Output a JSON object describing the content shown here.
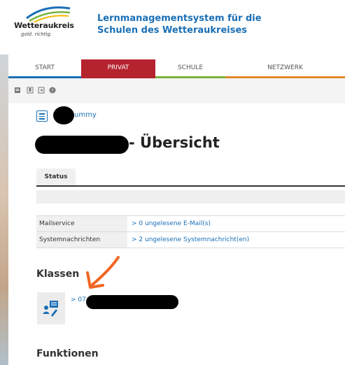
{
  "logo": {
    "name": "Wetteraukreis",
    "tagline": "gold. richtig."
  },
  "site": {
    "title_line1": "Lernmanagementsystem für die",
    "title_line2": "Schulen des Wetteraukreises"
  },
  "nav": {
    "tabs": [
      {
        "label": "START",
        "color": "#1a6fb5"
      },
      {
        "label": "PRIVAT",
        "color": "#b5232f"
      },
      {
        "label": "SCHULE",
        "color": "#7ab33e"
      },
      {
        "label": "NETZWERK",
        "color": "#e08a2c"
      }
    ]
  },
  "toolbar": {
    "icons": [
      "notes-icon",
      "bookmark-icon",
      "logout-icon",
      "help-icon"
    ]
  },
  "breadcrumb": {
    "text": "ummy"
  },
  "page": {
    "title_suffix": "- Übersicht"
  },
  "status_tab": {
    "label": "Status"
  },
  "status_table": [
    {
      "label": "Mailservice",
      "value": "> 0 ungelesene E-Mail(s)"
    },
    {
      "label": "Systemnachrichten",
      "value": "> 2 ungelesene Systemnachricht(en)"
    }
  ],
  "sections": {
    "klassen": "Klassen",
    "funktionen": "Funktionen"
  },
  "klassen": {
    "link_prefix": "> 07"
  },
  "colors": {
    "accent": "#1a6fb5",
    "privat": "#b5232f",
    "annotation_arrow": "#f26522"
  }
}
